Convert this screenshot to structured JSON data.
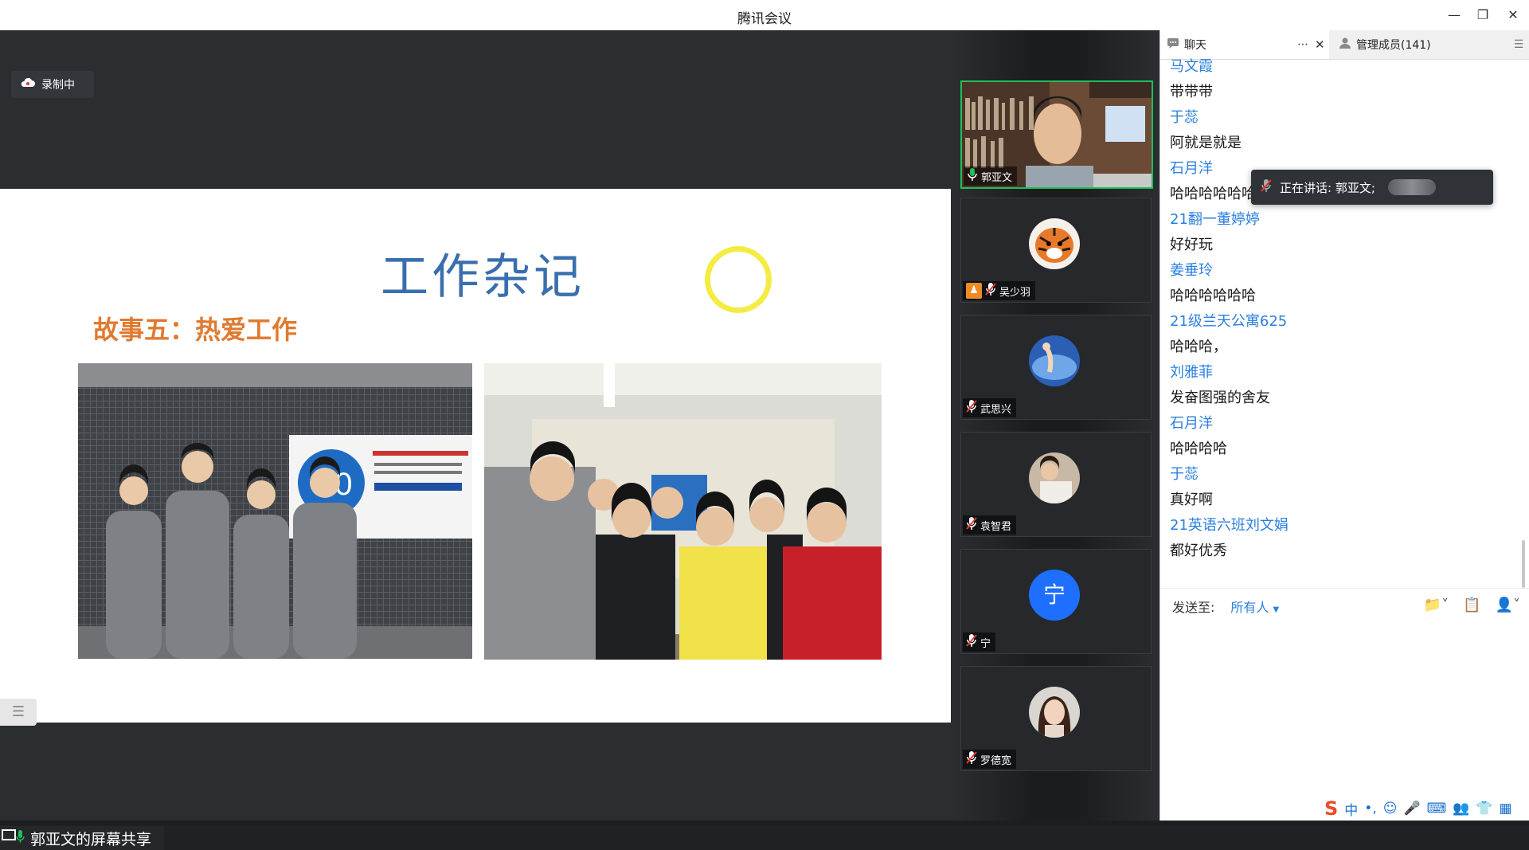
{
  "window": {
    "title": "腾讯会议",
    "minimize_icon": "minimize-icon",
    "restore_icon": "restore-icon",
    "close_icon": "close-icon"
  },
  "recording": {
    "label": "录制中",
    "icon": "cloud-record-icon"
  },
  "slide": {
    "title": "工作杂记",
    "subtitle": "故事五：热爱工作"
  },
  "screen_share": {
    "label": "郭亚文的屏幕共享",
    "icon": "screen-share-icon"
  },
  "participants": [
    {
      "name": "郭亚文",
      "mic": "on",
      "active_speaker": true,
      "video": true
    },
    {
      "name": "吴少羽",
      "mic": "muted",
      "avatar": "tiger",
      "host_badge": true
    },
    {
      "name": "武思兴",
      "mic": "muted",
      "avatar": "pool"
    },
    {
      "name": "袁智君",
      "mic": "muted",
      "avatar": "portrait"
    },
    {
      "name": "宁",
      "mic": "muted",
      "avatar_letter": "宁",
      "avatar_color": "#1f6fff"
    },
    {
      "name": "罗德宽",
      "mic": "muted",
      "avatar": "woman"
    }
  ],
  "chat_panel": {
    "tab_chat": "聊天",
    "tab_members": "管理成员(141)",
    "speaking": "正在讲话: 郭亚文;",
    "messages": [
      {
        "sender": "马文霞",
        "text": "带带带"
      },
      {
        "sender": "于蕊",
        "text": "阿就是就是"
      },
      {
        "sender": "石月洋",
        "text": "哈哈哈哈哈哈"
      },
      {
        "sender": "21翻一董婷婷",
        "text": "好好玩"
      },
      {
        "sender": "姜垂玲",
        "text": "哈哈哈哈哈哈"
      },
      {
        "sender": "21级兰天公寓625",
        "text": "哈哈哈，"
      },
      {
        "sender": "刘雅菲",
        "text": "发奋图强的舍友"
      },
      {
        "sender": "石月洋",
        "text": "哈哈哈哈"
      },
      {
        "sender": "于蕊",
        "text": "真好啊"
      },
      {
        "sender": "21英语六班刘文娟",
        "text": "都好优秀"
      }
    ],
    "send_to_label": "发送至:",
    "send_to_target": "所有人"
  },
  "ime": {
    "chinese_label": "中"
  },
  "colors": {
    "accent_blue": "#2b7fe0",
    "active_green": "#1fbf5a",
    "slide_title": "#3a6fae",
    "slide_subtitle": "#e07a30"
  }
}
